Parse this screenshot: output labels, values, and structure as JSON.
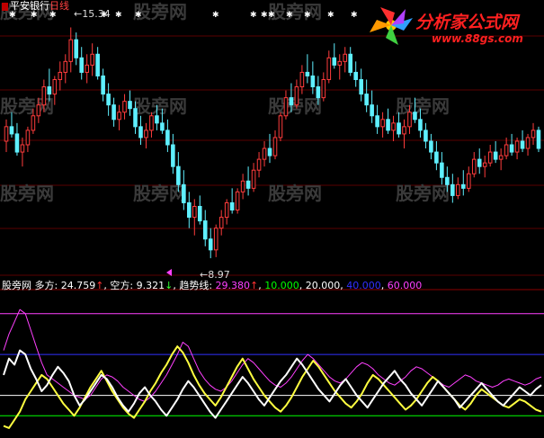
{
  "chart_data": {
    "type": "candlestick",
    "security": "平安银行",
    "period": "日线",
    "price_high_label": "15.34",
    "price_low_label": "8.97",
    "up_color": "#ff3c3c",
    "down_color": "#5ff0ff",
    "candles": [
      [
        12.2,
        12.8,
        11.9,
        12.6
      ],
      [
        12.6,
        13.0,
        12.3,
        12.4
      ],
      [
        12.4,
        12.7,
        11.8,
        11.9
      ],
      [
        11.9,
        12.3,
        11.5,
        12.1
      ],
      [
        12.1,
        12.6,
        11.9,
        12.5
      ],
      [
        12.5,
        13.1,
        12.4,
        12.9
      ],
      [
        12.9,
        13.4,
        12.7,
        13.2
      ],
      [
        13.2,
        13.9,
        13.0,
        13.7
      ],
      [
        13.7,
        14.2,
        13.3,
        13.5
      ],
      [
        13.5,
        14.0,
        13.2,
        13.9
      ],
      [
        13.9,
        14.4,
        13.6,
        14.1
      ],
      [
        14.1,
        14.6,
        13.8,
        14.4
      ],
      [
        14.4,
        15.34,
        14.1,
        15.0
      ],
      [
        15.0,
        15.2,
        14.3,
        14.5
      ],
      [
        14.5,
        14.8,
        13.9,
        14.1
      ],
      [
        14.1,
        14.6,
        13.8,
        14.3
      ],
      [
        14.3,
        14.9,
        14.0,
        14.6
      ],
      [
        14.6,
        14.8,
        13.9,
        14.0
      ],
      [
        14.0,
        14.2,
        13.3,
        13.5
      ],
      [
        13.5,
        13.8,
        12.9,
        13.2
      ],
      [
        13.2,
        13.4,
        12.6,
        12.8
      ],
      [
        12.8,
        13.2,
        12.5,
        13.0
      ],
      [
        13.0,
        13.5,
        12.8,
        13.3
      ],
      [
        13.3,
        13.6,
        12.9,
        13.1
      ],
      [
        13.1,
        13.3,
        12.4,
        12.6
      ],
      [
        12.6,
        12.9,
        12.1,
        12.3
      ],
      [
        12.3,
        12.7,
        12.0,
        12.5
      ],
      [
        12.5,
        13.0,
        12.3,
        12.9
      ],
      [
        12.9,
        13.2,
        12.5,
        12.7
      ],
      [
        12.7,
        13.1,
        12.4,
        12.5
      ],
      [
        12.5,
        12.8,
        11.9,
        12.1
      ],
      [
        12.1,
        12.4,
        11.3,
        11.5
      ],
      [
        11.5,
        11.9,
        10.8,
        11.0
      ],
      [
        11.0,
        11.4,
        10.3,
        10.5
      ],
      [
        10.5,
        10.8,
        9.8,
        10.1
      ],
      [
        10.1,
        10.6,
        9.6,
        10.4
      ],
      [
        10.4,
        10.7,
        9.9,
        10.0
      ],
      [
        10.0,
        10.3,
        9.3,
        9.5
      ],
      [
        9.5,
        9.8,
        8.97,
        9.2
      ],
      [
        9.2,
        9.9,
        9.0,
        9.8
      ],
      [
        9.8,
        10.3,
        9.6,
        10.1
      ],
      [
        10.1,
        10.6,
        9.9,
        10.5
      ],
      [
        10.5,
        10.9,
        10.2,
        10.3
      ],
      [
        10.3,
        10.9,
        10.2,
        10.8
      ],
      [
        10.8,
        11.3,
        10.6,
        11.1
      ],
      [
        11.1,
        11.5,
        10.7,
        10.9
      ],
      [
        10.9,
        11.6,
        10.8,
        11.4
      ],
      [
        11.4,
        11.9,
        11.2,
        11.7
      ],
      [
        11.7,
        12.2,
        11.5,
        12.0
      ],
      [
        12.0,
        12.4,
        11.6,
        11.8
      ],
      [
        11.8,
        12.5,
        11.7,
        12.3
      ],
      [
        12.3,
        13.0,
        12.2,
        12.9
      ],
      [
        12.9,
        13.6,
        12.8,
        13.4
      ],
      [
        13.4,
        13.8,
        13.0,
        13.2
      ],
      [
        13.2,
        13.9,
        13.1,
        13.7
      ],
      [
        13.7,
        14.3,
        13.5,
        14.1
      ],
      [
        14.1,
        14.6,
        13.8,
        14.0
      ],
      [
        14.0,
        14.4,
        13.5,
        13.7
      ],
      [
        13.7,
        14.0,
        13.2,
        13.4
      ],
      [
        13.4,
        14.1,
        13.3,
        13.9
      ],
      [
        13.9,
        14.7,
        13.8,
        14.5
      ],
      [
        14.5,
        14.9,
        14.2,
        14.3
      ],
      [
        14.3,
        14.6,
        13.9,
        14.4
      ],
      [
        14.4,
        14.8,
        14.1,
        14.6
      ],
      [
        14.6,
        14.8,
        14.0,
        14.1
      ],
      [
        14.1,
        14.4,
        13.7,
        13.9
      ],
      [
        13.9,
        14.2,
        13.3,
        13.5
      ],
      [
        13.5,
        13.9,
        13.0,
        13.2
      ],
      [
        13.2,
        13.6,
        12.7,
        12.9
      ],
      [
        12.9,
        13.2,
        12.4,
        12.6
      ],
      [
        12.6,
        13.0,
        12.3,
        12.8
      ],
      [
        12.8,
        13.1,
        12.4,
        12.5
      ],
      [
        12.5,
        12.9,
        12.2,
        12.7
      ],
      [
        12.7,
        13.0,
        12.3,
        12.4
      ],
      [
        12.4,
        12.8,
        12.0,
        12.6
      ],
      [
        12.6,
        13.2,
        12.4,
        13.0
      ],
      [
        13.0,
        13.4,
        12.7,
        12.8
      ],
      [
        12.8,
        13.1,
        12.3,
        12.5
      ],
      [
        12.5,
        12.7,
        12.0,
        12.2
      ],
      [
        12.2,
        12.4,
        11.7,
        11.9
      ],
      [
        11.9,
        12.2,
        11.4,
        11.6
      ],
      [
        11.6,
        11.9,
        11.0,
        11.2
      ],
      [
        11.2,
        11.5,
        10.8,
        11.0
      ],
      [
        11.0,
        11.3,
        10.5,
        10.7
      ],
      [
        10.7,
        11.2,
        10.6,
        11.0
      ],
      [
        11.0,
        11.4,
        10.7,
        10.9
      ],
      [
        10.9,
        11.5,
        10.8,
        11.3
      ],
      [
        11.3,
        11.9,
        11.2,
        11.7
      ],
      [
        11.7,
        12.0,
        11.3,
        11.5
      ],
      [
        11.5,
        11.8,
        11.2,
        11.6
      ],
      [
        11.6,
        12.1,
        11.5,
        11.9
      ],
      [
        11.9,
        12.2,
        11.6,
        11.7
      ],
      [
        11.7,
        12.0,
        11.4,
        11.8
      ],
      [
        11.8,
        12.3,
        11.7,
        12.1
      ],
      [
        12.1,
        12.4,
        11.8,
        11.9
      ],
      [
        11.9,
        12.3,
        11.7,
        12.2
      ],
      [
        12.2,
        12.5,
        11.9,
        12.0
      ],
      [
        12.0,
        12.4,
        11.8,
        12.3
      ],
      [
        12.3,
        12.7,
        12.1,
        12.5
      ],
      [
        12.5,
        12.6,
        11.9,
        12.0
      ]
    ],
    "indicator": {
      "name": "股旁网",
      "items": [
        {
          "label": "多方:",
          "value": "24.759",
          "arrow": "↑",
          "color": "#ffffff"
        },
        {
          "label": "空方:",
          "value": "9.321",
          "arrow": "↓",
          "color": "#ffffff"
        },
        {
          "label": "趋势线:",
          "value": "29.380",
          "arrow": "↑",
          "color": "#ff40ff"
        }
      ],
      "levels": [
        {
          "value": "10.000",
          "color": "#00ff00"
        },
        {
          "value": "20.000",
          "color": "#ffffff"
        },
        {
          "value": "40.000",
          "color": "#3030ff"
        },
        {
          "value": "60.000",
          "color": "#ff40ff"
        }
      ],
      "bulls": [
        30,
        38,
        35,
        42,
        40,
        33,
        28,
        22,
        25,
        30,
        34,
        31,
        27,
        20,
        15,
        18,
        22,
        26,
        30,
        28,
        24,
        19,
        15,
        12,
        16,
        21,
        24,
        20,
        17,
        13,
        10,
        14,
        18,
        23,
        27,
        24,
        20,
        16,
        12,
        9,
        13,
        17,
        21,
        25,
        29,
        26,
        22,
        18,
        15,
        19,
        23,
        27,
        30,
        34,
        38,
        35,
        31,
        27,
        23,
        20,
        17,
        21,
        25,
        28,
        24,
        20,
        17,
        14,
        18,
        22,
        26,
        29,
        32,
        28,
        25,
        21,
        18,
        15,
        19,
        23,
        27,
        24,
        21,
        18,
        14,
        17,
        20,
        23,
        26,
        23,
        20,
        17,
        15,
        18,
        21,
        24,
        22,
        20,
        23,
        25
      ],
      "bears": [
        5,
        4,
        8,
        12,
        18,
        22,
        26,
        30,
        28,
        24,
        20,
        16,
        13,
        10,
        14,
        19,
        24,
        28,
        32,
        27,
        22,
        18,
        14,
        11,
        9,
        13,
        17,
        22,
        26,
        31,
        35,
        40,
        44,
        41,
        36,
        30,
        25,
        21,
        18,
        15,
        19,
        24,
        29,
        34,
        38,
        33,
        28,
        24,
        20,
        17,
        14,
        12,
        15,
        19,
        24,
        29,
        33,
        37,
        34,
        30,
        26,
        22,
        19,
        16,
        14,
        17,
        21,
        26,
        30,
        28,
        25,
        22,
        19,
        16,
        13,
        15,
        18,
        22,
        26,
        29,
        27,
        24,
        21,
        18,
        15,
        13,
        16,
        20,
        23,
        21,
        19,
        17,
        15,
        14,
        16,
        18,
        17,
        15,
        13,
        12
      ],
      "trend": [
        42,
        50,
        56,
        62,
        60,
        52,
        44,
        36,
        30,
        28,
        26,
        24,
        22,
        20,
        19,
        18,
        20,
        24,
        28,
        30,
        29,
        27,
        24,
        22,
        20,
        18,
        17,
        19,
        22,
        26,
        30,
        35,
        40,
        46,
        44,
        38,
        32,
        28,
        25,
        23,
        22,
        24,
        27,
        31,
        35,
        38,
        36,
        33,
        30,
        27,
        25,
        24,
        26,
        29,
        33,
        37,
        40,
        38,
        35,
        32,
        29,
        27,
        26,
        28,
        31,
        34,
        36,
        35,
        33,
        30,
        28,
        26,
        25,
        27,
        29,
        32,
        34,
        33,
        31,
        29,
        27,
        25,
        24,
        26,
        28,
        30,
        29,
        27,
        26,
        25,
        24,
        25,
        27,
        28,
        27,
        26,
        25,
        26,
        28,
        29
      ]
    }
  },
  "watermark": "股旁网",
  "logo": {
    "name": "分析家公式网",
    "url": "www.88gs.com"
  }
}
